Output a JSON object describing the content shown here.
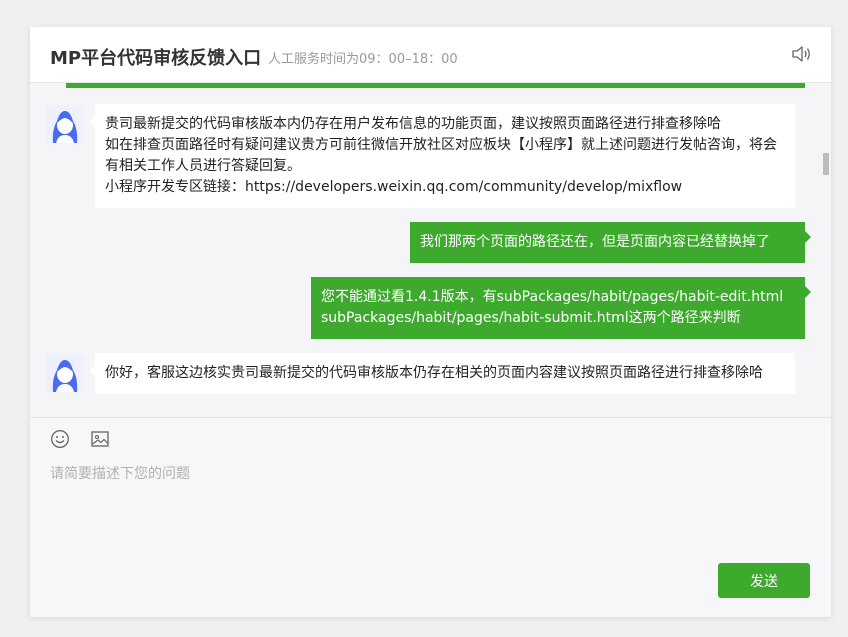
{
  "header": {
    "title": "MP平台代码审核反馈入口",
    "service_hours": "人工服务时间为09：00–18：00"
  },
  "messages": [
    {
      "side": "left",
      "lines": [
        "贵司最新提交的代码审核版本内仍存在用户发布信息的功能页面，建议按照页面路径进行排查移除哈",
        "如在排查页面路径时有疑问建议贵方可前往微信开放社区对应板块【小程序】就上述问题进行发帖咨询，将会有相关工作人员进行答疑回复。",
        "小程序开发专区链接：https://developers.weixin.qq.com/community/develop/mixflow"
      ]
    },
    {
      "side": "right",
      "lines": [
        "我们那两个页面的路径还在，但是页面内容已经替换掉了"
      ]
    },
    {
      "side": "right",
      "lines": [
        "您不能通过看1.4.1版本，有subPackages/habit/pages/habit-edit.html",
        "subPackages/habit/pages/habit-submit.html这两个路径来判断"
      ]
    },
    {
      "side": "left",
      "lines": [
        "你好，客服这边核实贵司最新提交的代码审核版本仍存在相关的页面内容建议按照页面路径进行排查移除哈"
      ]
    }
  ],
  "composer": {
    "placeholder": "请简要描述下您的问题",
    "send_label": "发送"
  },
  "colors": {
    "accent": "#3daa2e",
    "avatar_hair": "#4a6cf0"
  },
  "icons": {
    "speaker": "speaker-icon",
    "emoji": "emoji-icon",
    "image": "image-icon",
    "avatar": "agent-avatar-icon"
  }
}
